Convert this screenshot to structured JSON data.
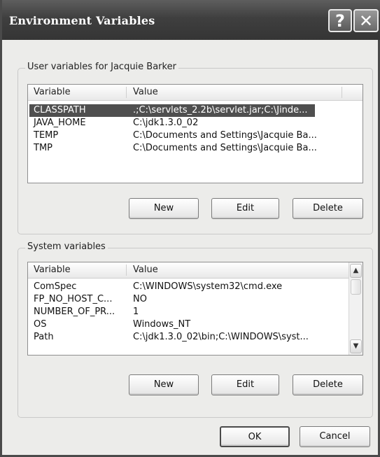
{
  "window": {
    "title": "Environment Variables",
    "help_glyph": "?",
    "close_glyph": "✕"
  },
  "user_group": {
    "label": "User variables for Jacquie Barker",
    "columns": [
      "Variable",
      "Value"
    ],
    "rows": [
      {
        "variable": "CLASSPATH",
        "value": ".;C:\\servlets_2.2b\\servlet.jar;C:\\Jinde...",
        "selected": true
      },
      {
        "variable": "JAVA_HOME",
        "value": "C:\\jdk1.3.0_02",
        "selected": false
      },
      {
        "variable": "TEMP",
        "value": "C:\\Documents and Settings\\Jacquie Ba...",
        "selected": false
      },
      {
        "variable": "TMP",
        "value": "C:\\Documents and Settings\\Jacquie Ba...",
        "selected": false
      }
    ],
    "buttons": {
      "new": "New",
      "edit": "Edit",
      "delete": "Delete"
    }
  },
  "system_group": {
    "label": "System variables",
    "columns": [
      "Variable",
      "Value"
    ],
    "rows": [
      {
        "variable": "ComSpec",
        "value": "C:\\WINDOWS\\system32\\cmd.exe"
      },
      {
        "variable": "FP_NO_HOST_C...",
        "value": "NO"
      },
      {
        "variable": "NUMBER_OF_PR...",
        "value": "1"
      },
      {
        "variable": "OS",
        "value": "Windows_NT"
      },
      {
        "variable": "Path",
        "value": "C:\\jdk1.3.0_02\\bin;C:\\WINDOWS\\syst..."
      }
    ],
    "scroll_up_glyph": "▲",
    "scroll_down_glyph": "▼",
    "buttons": {
      "new": "New",
      "edit": "Edit",
      "delete": "Delete"
    }
  },
  "footer": {
    "ok": "OK",
    "cancel": "Cancel"
  },
  "colors": {
    "titlebar": "#3f3f3f",
    "selection": "#4f4f4f",
    "dialog_bg": "#ececea"
  }
}
